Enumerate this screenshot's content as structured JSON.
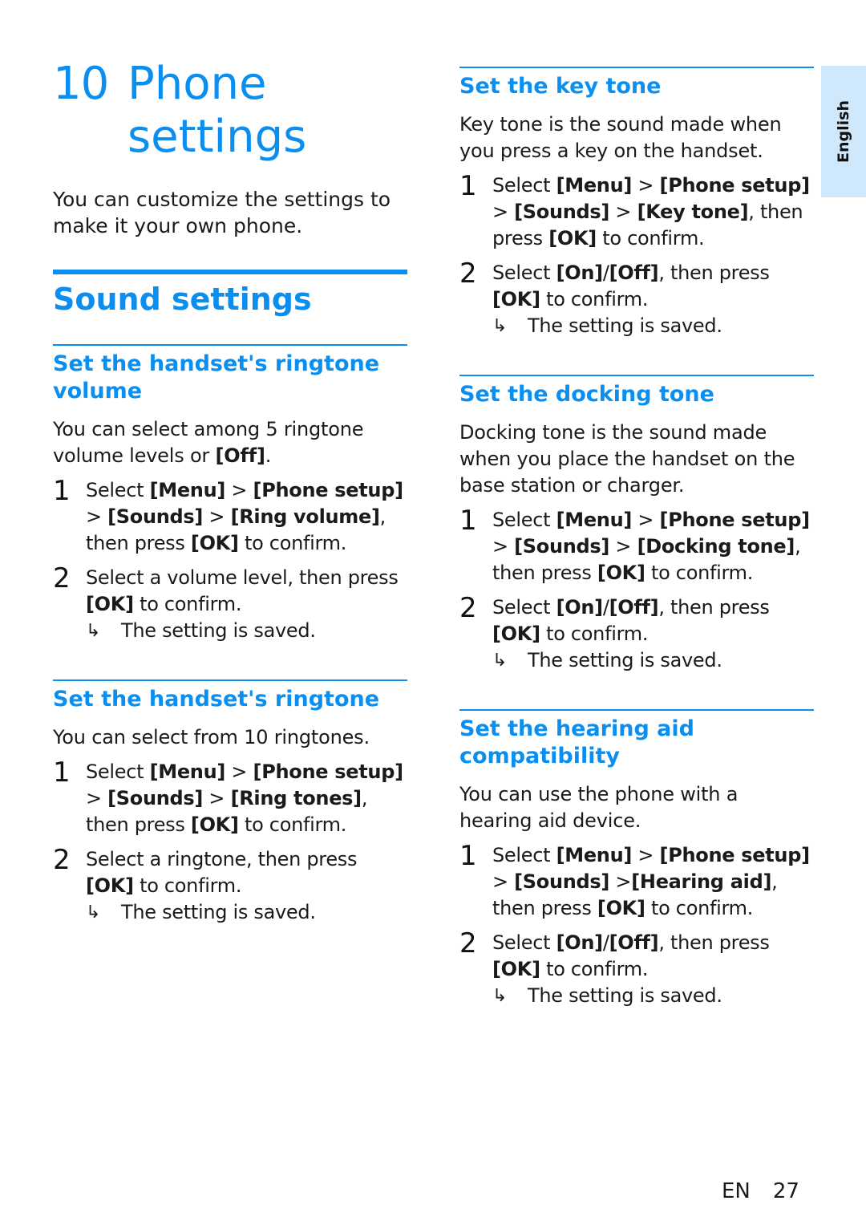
{
  "chapter": {
    "number": "10",
    "title": "Phone settings",
    "intro": "You can customize the settings to make it your own phone."
  },
  "section": {
    "title": "Sound settings"
  },
  "lang_tab": "English",
  "result_text": "The setting is saved.",
  "subsections": [
    {
      "id": "ringtone-volume",
      "title": "Set the handset's ringtone volume",
      "description": [
        {
          "t": "You can select among 5 ringtone volume levels or "
        },
        {
          "t": "[Off]",
          "b": true
        },
        {
          "t": "."
        }
      ],
      "steps": [
        [
          {
            "t": "Select "
          },
          {
            "t": "[Menu]",
            "b": true
          },
          {
            "t": " > "
          },
          {
            "t": "[Phone setup]",
            "b": true
          },
          {
            "t": " > "
          },
          {
            "t": "[Sounds]",
            "b": true
          },
          {
            "t": " > "
          },
          {
            "t": "[Ring volume]",
            "b": true
          },
          {
            "t": ", then press "
          },
          {
            "t": "[OK]",
            "b": true
          },
          {
            "t": " to confirm."
          }
        ],
        [
          {
            "t": "Select a volume level, then press "
          },
          {
            "t": "[OK]",
            "b": true
          },
          {
            "t": " to confirm."
          }
        ]
      ]
    },
    {
      "id": "ringtone",
      "title": "Set the handset's ringtone",
      "description": [
        {
          "t": "You can select from 10 ringtones."
        }
      ],
      "steps": [
        [
          {
            "t": "Select "
          },
          {
            "t": "[Menu]",
            "b": true
          },
          {
            "t": " > "
          },
          {
            "t": "[Phone setup]",
            "b": true
          },
          {
            "t": " > "
          },
          {
            "t": "[Sounds]",
            "b": true
          },
          {
            "t": " > "
          },
          {
            "t": "[Ring tones]",
            "b": true
          },
          {
            "t": ", then press "
          },
          {
            "t": "[OK]",
            "b": true
          },
          {
            "t": " to confirm."
          }
        ],
        [
          {
            "t": "Select a ringtone, then press "
          },
          {
            "t": "[OK]",
            "b": true
          },
          {
            "t": " to confirm."
          }
        ]
      ]
    },
    {
      "id": "key-tone",
      "title": "Set the key tone",
      "description": [
        {
          "t": "Key tone is the sound made when you press a key on the handset."
        }
      ],
      "steps": [
        [
          {
            "t": "Select "
          },
          {
            "t": "[Menu]",
            "b": true
          },
          {
            "t": " > "
          },
          {
            "t": "[Phone setup]",
            "b": true
          },
          {
            "t": " > "
          },
          {
            "t": "[Sounds]",
            "b": true
          },
          {
            "t": " > "
          },
          {
            "t": "[Key tone]",
            "b": true
          },
          {
            "t": ", then press "
          },
          {
            "t": "[OK]",
            "b": true
          },
          {
            "t": " to confirm."
          }
        ],
        [
          {
            "t": "Select "
          },
          {
            "t": "[On]",
            "b": true
          },
          {
            "t": "/"
          },
          {
            "t": "[Off]",
            "b": true
          },
          {
            "t": ", then press "
          },
          {
            "t": "[OK]",
            "b": true
          },
          {
            "t": " to confirm."
          }
        ]
      ]
    },
    {
      "id": "docking-tone",
      "title": "Set the docking tone",
      "description": [
        {
          "t": "Docking tone is the sound made when you place the handset on the base station or charger."
        }
      ],
      "steps": [
        [
          {
            "t": "Select "
          },
          {
            "t": "[Menu]",
            "b": true
          },
          {
            "t": " > "
          },
          {
            "t": "[Phone setup]",
            "b": true
          },
          {
            "t": " > "
          },
          {
            "t": "[Sounds]",
            "b": true
          },
          {
            "t": " > "
          },
          {
            "t": "[Docking tone]",
            "b": true
          },
          {
            "t": ", then press "
          },
          {
            "t": "[OK]",
            "b": true
          },
          {
            "t": " to confirm."
          }
        ],
        [
          {
            "t": "Select "
          },
          {
            "t": "[On]",
            "b": true
          },
          {
            "t": "/"
          },
          {
            "t": "[Off]",
            "b": true
          },
          {
            "t": ", then press "
          },
          {
            "t": "[OK]",
            "b": true
          },
          {
            "t": " to confirm."
          }
        ]
      ]
    },
    {
      "id": "hearing-aid",
      "title": "Set the hearing aid compatibility",
      "description": [
        {
          "t": "You can use the phone with a hearing aid device."
        }
      ],
      "steps": [
        [
          {
            "t": "Select "
          },
          {
            "t": "[Menu]",
            "b": true
          },
          {
            "t": " > "
          },
          {
            "t": "[Phone setup]",
            "b": true
          },
          {
            "t": " > "
          },
          {
            "t": "[Sounds]",
            "b": true
          },
          {
            "t": " >"
          },
          {
            "t": "[Hearing aid]",
            "b": true
          },
          {
            "t": ", then press "
          },
          {
            "t": "[OK]",
            "b": true
          },
          {
            "t": " to confirm."
          }
        ],
        [
          {
            "t": "Select "
          },
          {
            "t": "[On]",
            "b": true
          },
          {
            "t": "/"
          },
          {
            "t": "[Off]",
            "b": true
          },
          {
            "t": ", then press "
          },
          {
            "t": "[OK]",
            "b": true
          },
          {
            "t": " to confirm."
          }
        ]
      ]
    }
  ],
  "footer": {
    "lang": "EN",
    "page": "27"
  }
}
